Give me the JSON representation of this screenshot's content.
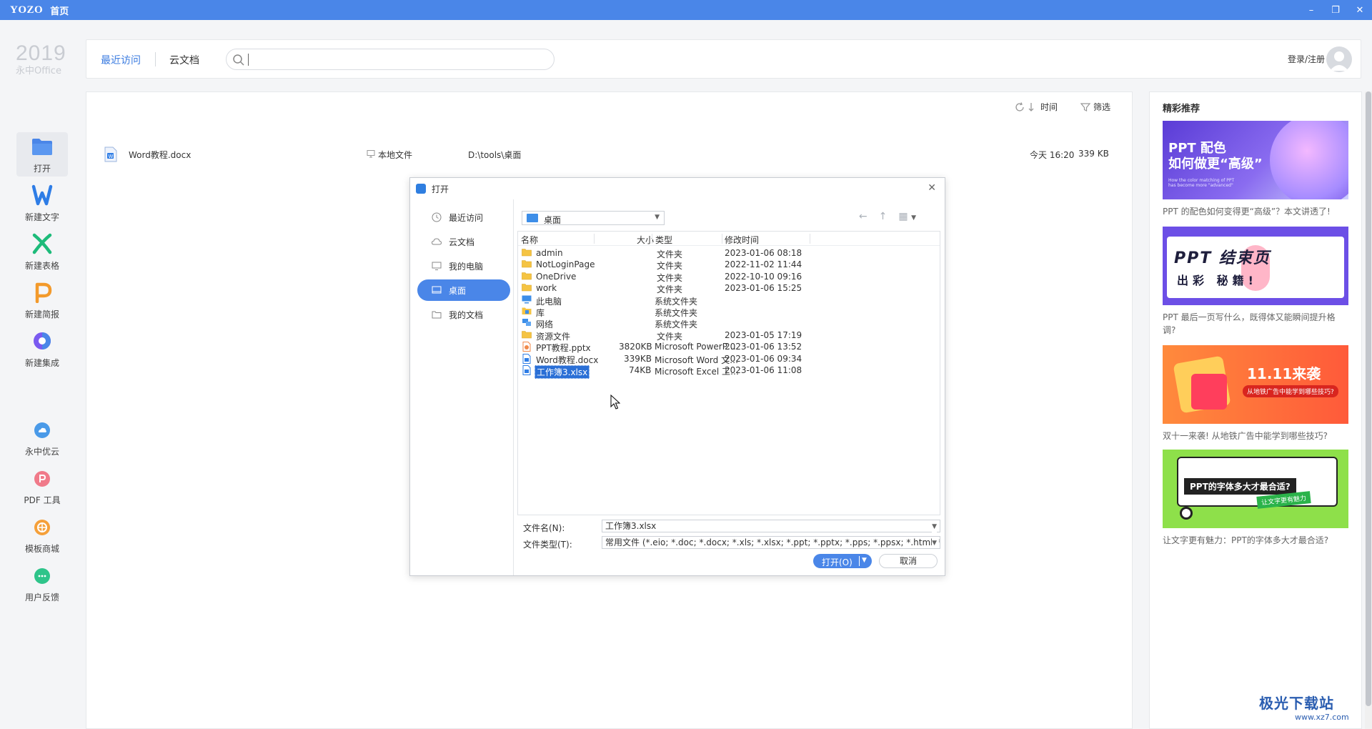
{
  "titlebar": {
    "brand": "YOZO",
    "title": "首页"
  },
  "logo": {
    "year": "2019",
    "name": "永中Office"
  },
  "sidebar": {
    "items": [
      {
        "label": "打开",
        "icon": "folder-icon"
      },
      {
        "label": "新建文字",
        "icon": "word-icon"
      },
      {
        "label": "新建表格",
        "icon": "excel-icon"
      },
      {
        "label": "新建简报",
        "icon": "ppt-icon"
      },
      {
        "label": "新建集成",
        "icon": "integration-icon"
      }
    ],
    "tools": [
      {
        "label": "永中优云",
        "icon": "cloud-icon"
      },
      {
        "label": "PDF 工具",
        "icon": "pdf-icon"
      },
      {
        "label": "模板商城",
        "icon": "template-icon"
      },
      {
        "label": "用户反馈",
        "icon": "feedback-icon"
      }
    ]
  },
  "header": {
    "tabs": [
      "最近访问",
      "云文档"
    ],
    "search_placeholder": "",
    "login": "登录/注册"
  },
  "main": {
    "sort_label": "时间",
    "filter_label": "筛选",
    "recent": [
      {
        "name": "Word教程.docx",
        "location": "本地文件",
        "path": "D:\\tools\\桌面",
        "time": "今天 16:20",
        "size": "339 KB"
      }
    ]
  },
  "right": {
    "title": "精彩推荐",
    "cards": [
      {
        "img_title": "PPT 配色\n如何做更“高级”",
        "img_sub": "How the color matching of PPT has become more \"advanced\"",
        "caption": "PPT 的配色如何变得更“高级”？本文讲透了!"
      },
      {
        "img_title": "PPT 结束页",
        "img_sub": "出彩 秘籍!",
        "caption": "PPT 最后一页写什么，既得体又能瞬间提升格调?"
      },
      {
        "img_title": "11.11来袭",
        "img_sub": "从地铁广告中能学到哪些技巧?",
        "caption": "双十一来袭! 从地铁广告中能学到哪些技巧?"
      },
      {
        "img_title": "PPT的字体多大才最合适?",
        "img_sub": "让文字更有魅力",
        "caption": "让文字更有魅力：PPT的字体多大才最合适?"
      }
    ]
  },
  "dialog": {
    "title": "打开",
    "nav": [
      "最近访问",
      "云文档",
      "我的电脑",
      "桌面",
      "我的文档"
    ],
    "location": "桌面",
    "columns": {
      "name": "名称",
      "size": "大小",
      "type": "类型",
      "modified": "修改时间"
    },
    "files": [
      {
        "name": "admin",
        "size": "",
        "type": "文件夹",
        "modified": "2023-01-06 08:18",
        "icon": "folder-icon"
      },
      {
        "name": "NotLoginPage",
        "size": "",
        "type": "文件夹",
        "modified": "2022-11-02 11:44",
        "icon": "folder-icon"
      },
      {
        "name": "OneDrive",
        "size": "",
        "type": "文件夹",
        "modified": "2022-10-10 09:16",
        "icon": "folder-icon"
      },
      {
        "name": "work",
        "size": "",
        "type": "文件夹",
        "modified": "2023-01-06 15:25",
        "icon": "folder-icon"
      },
      {
        "name": "此电脑",
        "size": "",
        "type": "系统文件夹",
        "modified": "",
        "icon": "computer-icon"
      },
      {
        "name": "库",
        "size": "",
        "type": "系统文件夹",
        "modified": "",
        "icon": "library-icon"
      },
      {
        "name": "网络",
        "size": "",
        "type": "系统文件夹",
        "modified": "",
        "icon": "network-icon"
      },
      {
        "name": "资源文件",
        "size": "",
        "type": "文件夹",
        "modified": "2023-01-05 17:19",
        "icon": "folder-icon"
      },
      {
        "name": "PPT教程.pptx",
        "size": "3820KB",
        "type": "Microsoft PowerP…",
        "modified": "2023-01-06 13:52",
        "icon": "pptx-file-icon"
      },
      {
        "name": "Word教程.docx",
        "size": "339KB",
        "type": "Microsoft Word 文…",
        "modified": "2023-01-06 09:34",
        "icon": "docx-file-icon"
      },
      {
        "name": "工作簿3.xlsx",
        "size": "74KB",
        "type": "Microsoft Excel 工…",
        "modified": "2023-01-06 11:08",
        "icon": "xlsx-file-icon"
      }
    ],
    "filename_label": "文件名(N):",
    "filename_value": "工作簿3.xlsx",
    "filetype_label": "文件类型(T):",
    "filetype_value": "常用文件 (*.eio; *.doc; *.docx; *.xls; *.xlsx; *.ppt; *.pptx; *.pps; *.ppsx; *.html; *.h…",
    "open_label": "打开(O)",
    "cancel_label": "取消"
  },
  "watermark": {
    "line1": "极光下载站",
    "line2": "www.xz7.com"
  },
  "colors": {
    "accent": "#4a86e8",
    "selected": "#2a6fd6",
    "folder": "#f5c443"
  }
}
